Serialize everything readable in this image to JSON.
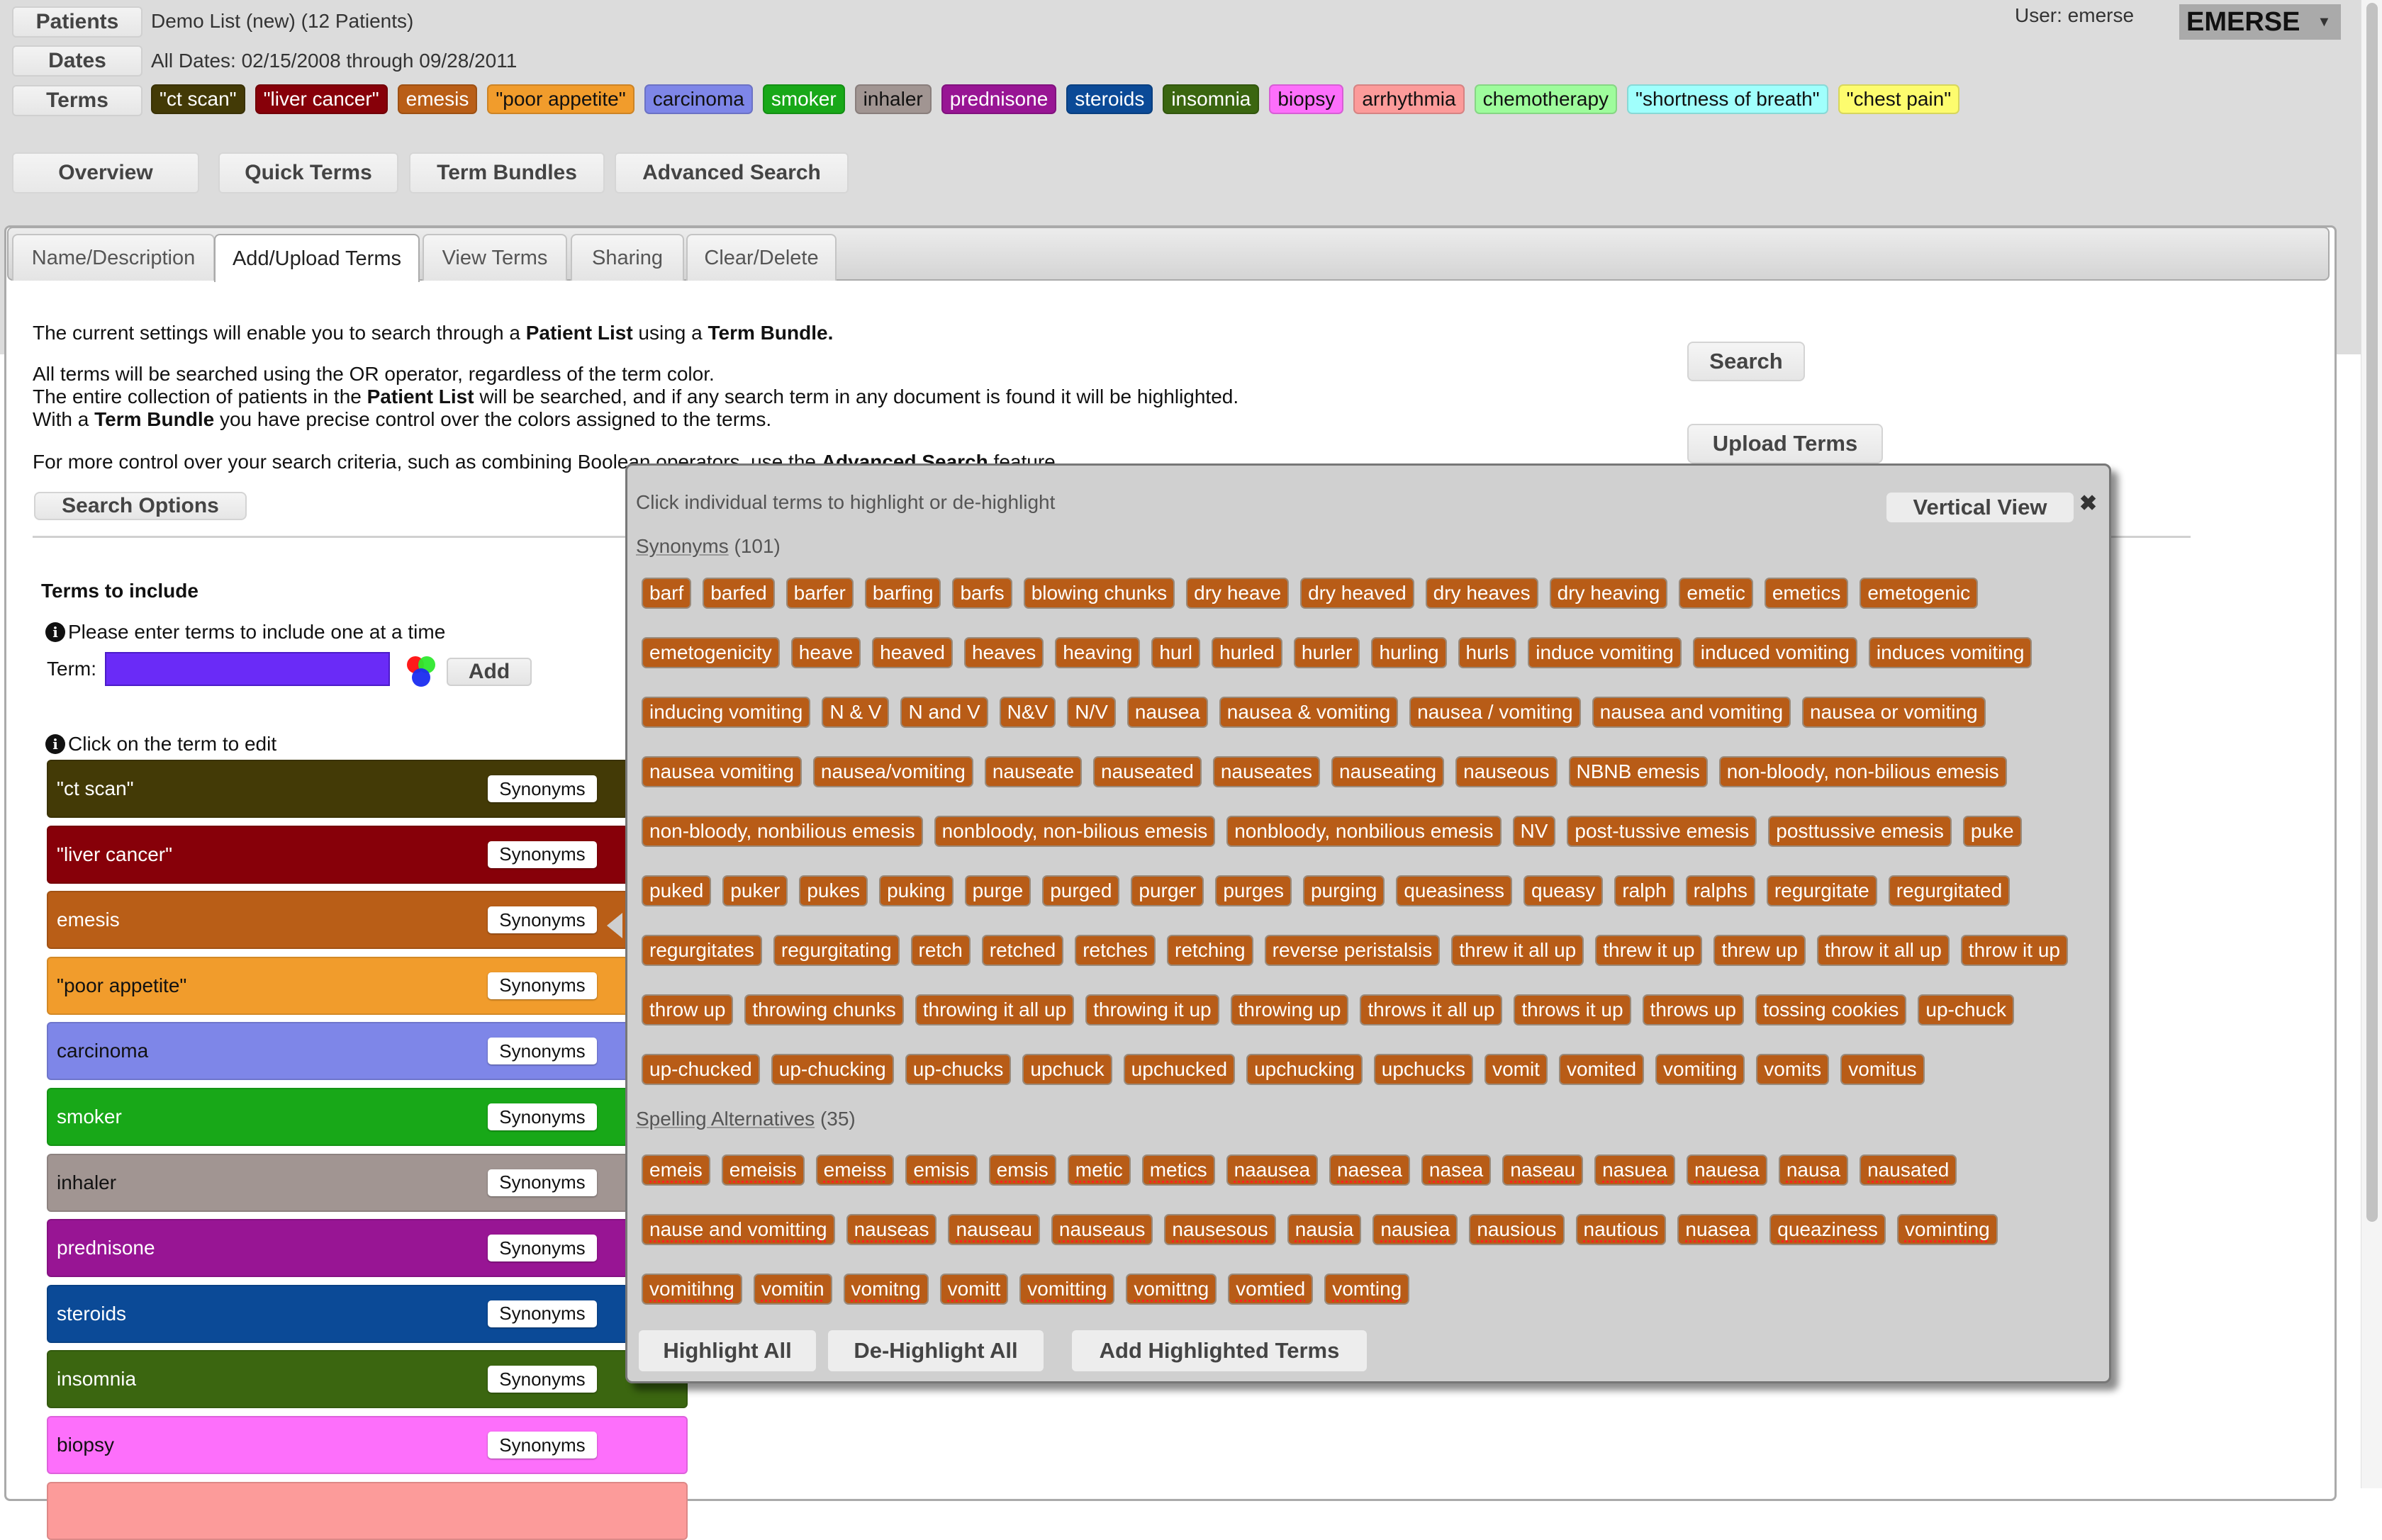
{
  "header": {
    "patients_label": "Patients",
    "patients_value": "Demo List (new) (12 Patients)",
    "dates_label": "Dates",
    "dates_value": "All Dates: 02/15/2008 through 09/28/2011",
    "terms_label": "Terms",
    "user": "User: emerse",
    "brand": "EMERSE",
    "brand_caret": "▼",
    "terms": [
      {
        "label": "\"ct scan\"",
        "bg": "#433a06",
        "fg": "#ffffff"
      },
      {
        "label": "\"liver cancer\"",
        "bg": "#870009",
        "fg": "#ffffff"
      },
      {
        "label": "emesis",
        "bg": "#b95e17",
        "fg": "#ffffff"
      },
      {
        "label": "\"poor appetite\"",
        "bg": "#f19c2c",
        "fg": "#111111"
      },
      {
        "label": "carcinoma",
        "bg": "#7e86e8",
        "fg": "#111111"
      },
      {
        "label": "smoker",
        "bg": "#18a818",
        "fg": "#ffffff"
      },
      {
        "label": "inhaler",
        "bg": "#a19592",
        "fg": "#111111"
      },
      {
        "label": "prednisone",
        "bg": "#981594",
        "fg": "#ffffff"
      },
      {
        "label": "steroids",
        "bg": "#0b4a97",
        "fg": "#ffffff"
      },
      {
        "label": "insomnia",
        "bg": "#3b6610",
        "fg": "#ffffff"
      },
      {
        "label": "biopsy",
        "bg": "#fd6ffb",
        "fg": "#111111"
      },
      {
        "label": "arrhythmia",
        "bg": "#fc9b9a",
        "fg": "#111111"
      },
      {
        "label": "chemotherapy",
        "bg": "#9efc9c",
        "fg": "#111111"
      },
      {
        "label": "\"shortness of breath\"",
        "bg": "#a0fffc",
        "fg": "#111111"
      },
      {
        "label": "\"chest pain\"",
        "bg": "#fdfc6e",
        "fg": "#111111"
      }
    ]
  },
  "nav": [
    "Overview",
    "Quick Terms",
    "Term Bundles",
    "Advanced Search"
  ],
  "tabs": [
    {
      "label": "Name/Description",
      "active": false
    },
    {
      "label": "Add/Upload Terms",
      "active": true
    },
    {
      "label": "View Terms",
      "active": false
    },
    {
      "label": "Sharing",
      "active": false
    },
    {
      "label": "Clear/Delete",
      "active": false
    }
  ],
  "description": {
    "line1_a": "The current settings will enable you to search through a ",
    "line1_b": "Patient List",
    "line1_c": " using a ",
    "line1_d": "Term Bundle.",
    "line2": "All terms will be searched using the OR operator, regardless of the term color.",
    "line3_a": "The entire collection of patients in the ",
    "line3_b": "Patient List",
    "line3_c": " will be searched, and if any search term in any document is found it will be highlighted.",
    "line4_a": "With a ",
    "line4_b": "Term Bundle",
    "line4_c": " you have precise control over the colors assigned to the terms.",
    "line5_a": "For more control over your search criteria, such as combining Boolean operators, use the ",
    "line5_b": "Advanced Search",
    "line5_c": " feature."
  },
  "actions": {
    "search": "Search",
    "upload_terms": "Upload Terms",
    "search_options": "Search Options"
  },
  "include": {
    "heading": "Terms to include",
    "hint_enter": "Please enter terms to include one at a time",
    "term_label": "Term:",
    "term_value": "",
    "add": "Add",
    "hint_edit": "Click on the term to edit",
    "synonyms_label": "Synonyms",
    "rows": [
      {
        "label": "\"ct scan\"",
        "bg": "#433a06",
        "fg": "#ffffff"
      },
      {
        "label": "\"liver cancer\"",
        "bg": "#870009",
        "fg": "#ffffff"
      },
      {
        "label": "emesis",
        "bg": "#b95e17",
        "fg": "#ffffff"
      },
      {
        "label": "\"poor appetite\"",
        "bg": "#f19c2c",
        "fg": "#111111"
      },
      {
        "label": "carcinoma",
        "bg": "#7e86e8",
        "fg": "#111111"
      },
      {
        "label": "smoker",
        "bg": "#18a818",
        "fg": "#ffffff"
      },
      {
        "label": "inhaler",
        "bg": "#a19592",
        "fg": "#111111"
      },
      {
        "label": "prednisone",
        "bg": "#981594",
        "fg": "#ffffff"
      },
      {
        "label": "steroids",
        "bg": "#0b4a97",
        "fg": "#ffffff"
      },
      {
        "label": "insomnia",
        "bg": "#3b6610",
        "fg": "#ffffff"
      },
      {
        "label": "biopsy",
        "bg": "#fd6ffb",
        "fg": "#111111"
      },
      {
        "label": "",
        "bg": "#fc9b9a",
        "fg": "#111111"
      }
    ]
  },
  "popup": {
    "hint": "Click individual terms to highlight or de-highlight",
    "vertical_view": "Vertical View",
    "close": "✖",
    "synonyms_title": "Synonyms",
    "synonyms_count": "(101)",
    "synonyms": [
      "barf",
      "barfed",
      "barfer",
      "barfing",
      "barfs",
      "blowing chunks",
      "dry heave",
      "dry heaved",
      "dry heaves",
      "dry heaving",
      "emetic",
      "emetics",
      "emetogenic",
      "emetogenicity",
      "heave",
      "heaved",
      "heaves",
      "heaving",
      "hurl",
      "hurled",
      "hurler",
      "hurling",
      "hurls",
      "induce vomiting",
      "induced vomiting",
      "induces vomiting",
      "inducing vomiting",
      "N & V",
      "N and V",
      "N&V",
      "N/V",
      "nausea",
      "nausea & vomiting",
      "nausea / vomiting",
      "nausea and vomiting",
      "nausea or vomiting",
      "nausea vomiting",
      "nausea/vomiting",
      "nauseate",
      "nauseated",
      "nauseates",
      "nauseating",
      "nauseous",
      "NBNB emesis",
      "non-bloody, non-bilious emesis",
      "non-bloody, nonbilious emesis",
      "nonbloody, non-bilious emesis",
      "nonbloody, nonbilious emesis",
      "NV",
      "post-tussive emesis",
      "posttussive emesis",
      "puke",
      "puked",
      "puker",
      "pukes",
      "puking",
      "purge",
      "purged",
      "purger",
      "purges",
      "purging",
      "queasiness",
      "queasy",
      "ralph",
      "ralphs",
      "regurgitate",
      "regurgitated",
      "regurgitates",
      "regurgitating",
      "retch",
      "retched",
      "retches",
      "retching",
      "reverse peristalsis",
      "threw it all up",
      "threw it up",
      "threw up",
      "throw it all up",
      "throw it up",
      "throw up",
      "throwing chunks",
      "throwing it all up",
      "throwing it up",
      "throwing up",
      "throws it all up",
      "throws it up",
      "throws up",
      "tossing cookies",
      "up-chuck",
      "up-chucked",
      "up-chucking",
      "up-chucks",
      "upchuck",
      "upchucked",
      "upchucking",
      "upchucks",
      "vomit",
      "vomited",
      "vomiting",
      "vomits",
      "vomitus"
    ],
    "spelling_title": "Spelling Alternatives",
    "spelling_count": "(35)",
    "spelling": [
      "emeis",
      "emeisis",
      "emeiss",
      "emisis",
      "emsis",
      "metic",
      "metics",
      "naausea",
      "naesea",
      "nasea",
      "naseau",
      "nasuea",
      "nauesa",
      "nausa",
      "nausated",
      "nause and vomitting",
      "nauseas",
      "nauseau",
      "nauseaus",
      "nausesous",
      "nausia",
      "nausiea",
      "nausious",
      "nautious",
      "nuasea",
      "queaziness",
      "vominting",
      "vomitihng",
      "vomitin",
      "vomitng",
      "vomitt",
      "vomitting",
      "vomittng",
      "vomtied",
      "vomting"
    ],
    "highlight_all": "Highlight All",
    "dehighlight_all": "De-Highlight All",
    "add_highlighted": "Add Highlighted Terms"
  }
}
